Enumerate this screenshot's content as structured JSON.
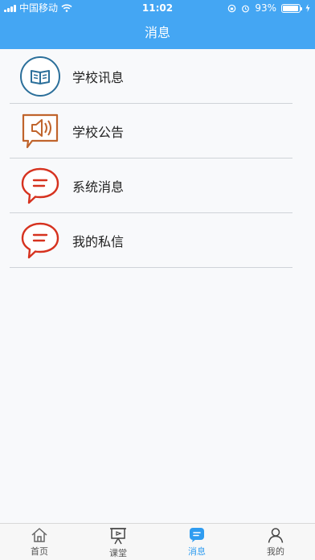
{
  "status_bar": {
    "carrier": "中国移动",
    "time": "11:02",
    "battery": "93%",
    "battery_level": 0.93
  },
  "nav": {
    "title": "消息"
  },
  "colors": {
    "header_bg": "#44a6f3",
    "accent": "#2f9cf0",
    "school_news_icon": "#2b6f9a",
    "announcement_icon": "#c0642c",
    "message_icon": "#d6321f"
  },
  "list": {
    "items": [
      {
        "label": "学校讯息",
        "icon": "book-icon"
      },
      {
        "label": "学校公告",
        "icon": "speaker-icon"
      },
      {
        "label": "系统消息",
        "icon": "chat-bubble-icon"
      },
      {
        "label": "我的私信",
        "icon": "chat-bubble-icon"
      }
    ]
  },
  "tabbar": {
    "tabs": [
      {
        "label": "首页",
        "icon": "home-icon",
        "active": false
      },
      {
        "label": "课堂",
        "icon": "presentation-board-icon",
        "active": false
      },
      {
        "label": "消息",
        "icon": "message-icon",
        "active": true
      },
      {
        "label": "我的",
        "icon": "person-icon",
        "active": false
      }
    ]
  }
}
